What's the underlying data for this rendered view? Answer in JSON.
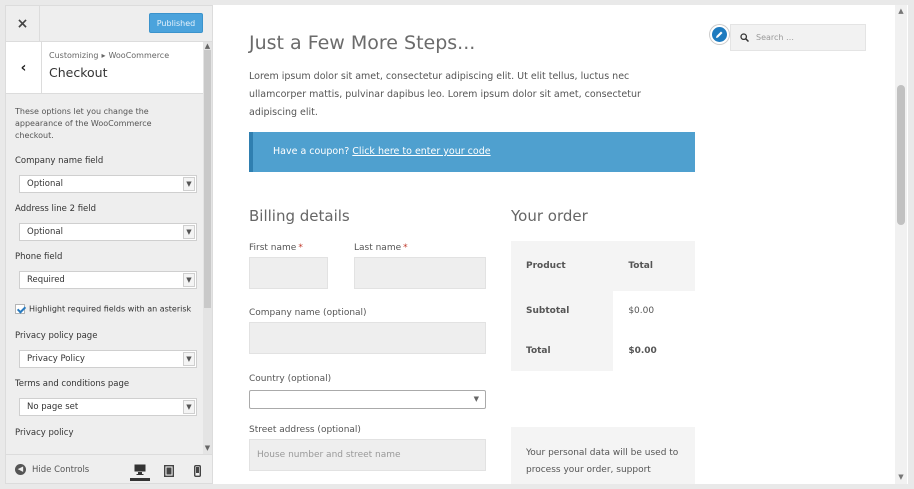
{
  "sidebar": {
    "close_icon": "×",
    "publish_label": "Published",
    "back_icon": "‹",
    "breadcrumb": {
      "part1": "Customizing",
      "separator": "▸",
      "part2": "WooCommerce"
    },
    "section_title": "Checkout",
    "description": "These options let you change the appearance of the WooCommerce checkout.",
    "controls": [
      {
        "label": "Company name field",
        "value": "Optional"
      },
      {
        "label": "Address line 2 field",
        "value": "Optional"
      },
      {
        "label": "Phone field",
        "value": "Required"
      }
    ],
    "checkbox": {
      "label": "Highlight required fields with an asterisk",
      "checked": true
    },
    "privacy_page": {
      "label": "Privacy policy page",
      "value": "Privacy Policy"
    },
    "terms_page": {
      "label": "Terms and conditions page",
      "value": "No page set"
    },
    "privacy_policy_label": "Privacy policy",
    "footer": {
      "hide_controls": "Hide Controls",
      "active_device": "desktop"
    }
  },
  "preview": {
    "page_title": "Just a Few More Steps...",
    "intro": "Lorem ipsum dolor sit amet, consectetur adipiscing elit. Ut elit tellus, luctus nec ullamcorper mattis, pulvinar dapibus leo. Lorem ipsum dolor sit amet, consectetur adipiscing elit.",
    "coupon": {
      "text": "Have a coupon?",
      "link": "Click here to enter your code"
    },
    "billing": {
      "heading": "Billing details",
      "first_name": "First name",
      "last_name": "Last name",
      "required_mark": "*",
      "company": "Company name (optional)",
      "country": "Country (optional)",
      "street": "Street address (optional)",
      "street_placeholder": "House number and street name"
    },
    "order": {
      "heading": "Your order",
      "col_product": "Product",
      "col_total": "Total",
      "subtotal_label": "Subtotal",
      "subtotal_value": "$0.00",
      "total_label": "Total",
      "total_value": "$0.00",
      "privacy_text": "Your personal data will be used to process your order, support"
    },
    "search_placeholder": "Search …"
  },
  "colors": {
    "publish": "#4ba3dc",
    "coupon_bg": "#4fa0cf",
    "edit_pen": "#1e7bbf"
  }
}
